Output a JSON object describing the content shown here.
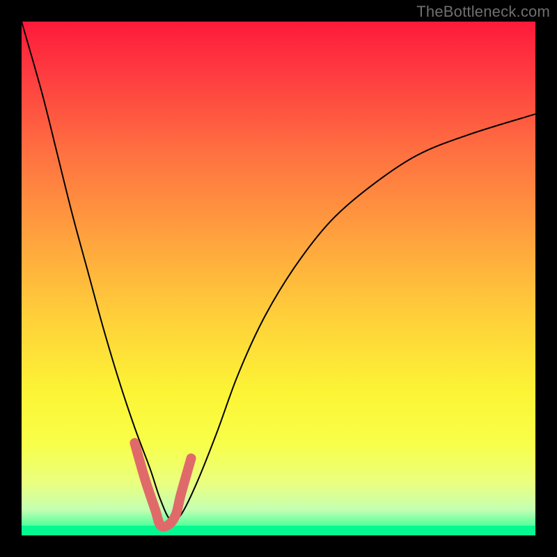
{
  "watermark": "TheBottleneck.com",
  "chart_data": {
    "type": "line",
    "title": "",
    "xlabel": "",
    "ylabel": "",
    "xlim": [
      0,
      100
    ],
    "ylim": [
      0,
      100
    ],
    "grid": false,
    "legend": false,
    "series": [
      {
        "name": "black-curve",
        "x": [
          0,
          4,
          7,
          10,
          13,
          16,
          19,
          22,
          25,
          27,
          29,
          31,
          34,
          38,
          42,
          47,
          53,
          60,
          68,
          77,
          87,
          100
        ],
        "values": [
          100,
          86,
          74,
          62,
          51,
          40,
          30,
          21,
          13,
          7,
          3,
          4,
          10,
          20,
          31,
          42,
          52,
          61,
          68,
          74,
          78,
          82
        ],
        "stroke": "#000000",
        "width": 2
      },
      {
        "name": "pink-marker",
        "x": [
          22,
          24,
          26,
          27,
          28.5,
          30,
          31,
          33
        ],
        "values": [
          18,
          11,
          5,
          2,
          2,
          4,
          8,
          15
        ],
        "stroke": "#e06a6a",
        "width": 14,
        "linecap": "round"
      }
    ],
    "annotations": []
  },
  "colors": {
    "background": "#000000",
    "gradient_top": "#fe1a3a",
    "gradient_bottom": "#06f991",
    "curve": "#000000",
    "marker": "#e06a6a",
    "watermark": "#6f6f6f"
  }
}
